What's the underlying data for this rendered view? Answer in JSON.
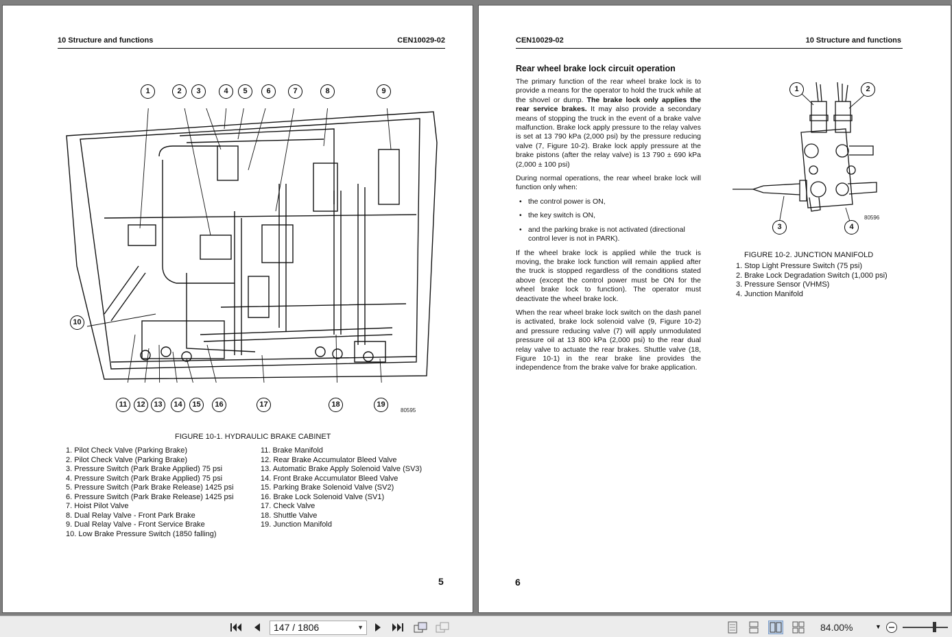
{
  "left_page": {
    "header_left": "10 Structure and functions",
    "header_right": "CEN10029-02",
    "callouts_top": [
      "1",
      "2",
      "3",
      "4",
      "5",
      "6",
      "7",
      "8",
      "9"
    ],
    "callout_side": "10",
    "callouts_bottom": [
      "11",
      "12",
      "13",
      "14",
      "15",
      "16",
      "17",
      "18",
      "19"
    ],
    "figure_number": "80595",
    "figure_caption": "FIGURE 10-1. HYDRAULIC BRAKE CABINET",
    "legend_col1": [
      " 1. Pilot Check Valve (Parking Brake)",
      " 2. Pilot Check Valve (Parking Brake)",
      " 3. Pressure Switch (Park Brake Applied) 75 psi",
      " 4. Pressure Switch (Park Brake Applied) 75 psi",
      " 5. Pressure Switch (Park Brake Release) 1425 psi",
      " 6. Pressure Switch (Park Brake Release) 1425 psi",
      " 7. Hoist Pilot Valve",
      " 8. Dual Relay Valve - Front Park Brake",
      " 9. Dual Relay Valve - Front Service Brake",
      "10. Low Brake Pressure Switch (1850 falling)"
    ],
    "legend_col2": [
      "11. Brake Manifold",
      "12. Rear Brake Accumulator Bleed Valve",
      "13. Automatic Brake Apply Solenoid Valve (SV3)",
      "14. Front Brake Accumulator Bleed Valve",
      "15. Parking Brake Solenoid Valve (SV2)",
      "16. Brake Lock Solenoid Valve (SV1)",
      "17. Check Valve",
      "18. Shuttle Valve",
      "19. Junction Manifold"
    ],
    "page_number": "5"
  },
  "right_page": {
    "header_left": "CEN10029-02",
    "header_right": "10 Structure and functions",
    "section_title": "Rear wheel brake lock circuit operation",
    "para1_a": "The primary function of the rear wheel brake lock is to provide a means for the operator to hold the truck while at the shovel or dump. ",
    "para1_bold": "The brake lock only applies the rear service brakes.",
    "para1_b": " It may also provide a secondary means of stopping the truck in the event of a brake valve malfunction. Brake lock apply pressure to the relay valves is set at 13 790 kPa (2,000 psi) by the pressure reducing valve (7, Figure 10-2). Brake lock apply pressure at the brake pistons (after the relay valve) is 13 790 ± 690 kPa (2,000 ± 100 psi)",
    "para2": "During normal operations, the rear wheel brake lock will function only when:",
    "bullets": [
      "the control power is ON,",
      "the key switch is ON,",
      "and the parking brake is not activated (directional control lever is not in PARK)."
    ],
    "para3": "If the wheel brake lock is applied while the truck is moving, the brake lock function will remain applied after the truck is stopped regardless of the conditions stated above (except the control power must be ON for the wheel brake lock to function). The operator must deactivate the wheel brake lock.",
    "para4": "When the rear wheel brake lock switch on the dash panel is activated, brake lock solenoid valve (9, Figure 10-2) and pressure reducing valve (7) will apply unmodulated pressure oil at 13 800 kPa (2,000 psi) to the rear dual relay valve to actuate the rear brakes. Shuttle valve (18, Figure 10-1) in the rear brake line provides the independence from the brake valve for brake application.",
    "callouts": [
      "1",
      "2",
      "3",
      "4"
    ],
    "figure_number": "80596",
    "figure_caption": "FIGURE 10-2. JUNCTION MANIFOLD",
    "legend": [
      "1. Stop Light Pressure Switch (75 psi)",
      "2. Brake Lock Degradation Switch (1,000 psi)",
      "3. Pressure Sensor (VHMS)",
      "4. Junction Manifold"
    ],
    "page_number": "6"
  },
  "toolbar": {
    "page_field": "147 / 1806",
    "zoom": "84.00%",
    "icons": [
      "first-page-icon",
      "previous-page-icon",
      "next-page-icon",
      "last-page-icon",
      "rotate-icon",
      "thumbnail-icon",
      "single-page-view-icon",
      "continuous-view-icon",
      "two-page-view-icon",
      "two-page-continuous-view-icon",
      "zoom-out-icon"
    ]
  }
}
